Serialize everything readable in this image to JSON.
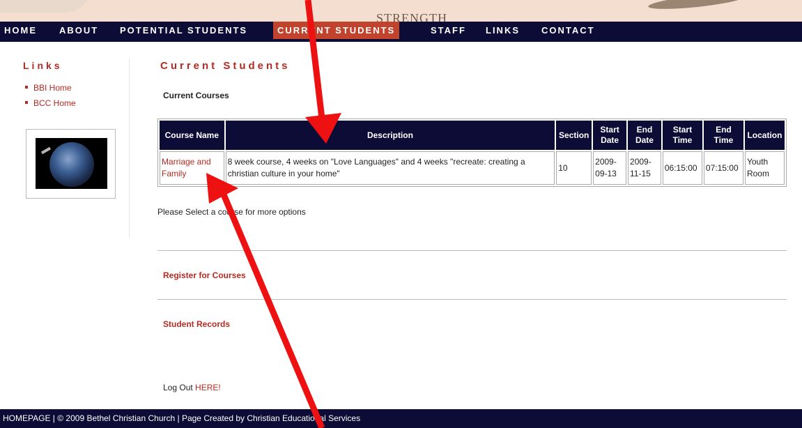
{
  "banner": {
    "text": "STRENGTH"
  },
  "nav": {
    "items": [
      {
        "label": "HOME"
      },
      {
        "label": "ABOUT"
      },
      {
        "label": "POTENTIAL STUDENTS"
      },
      {
        "label": "CURRENT STUDENTS"
      },
      {
        "label": "STAFF"
      },
      {
        "label": "LINKS"
      },
      {
        "label": "CONTACT"
      }
    ],
    "active_color": "#c0432e",
    "bar_color": "#0c0c36"
  },
  "sidebar": {
    "title": "Links",
    "links": [
      {
        "label": "BBI Home"
      },
      {
        "label": "BCC Home"
      }
    ]
  },
  "main": {
    "title": "Current Students",
    "subtitle": "Current Courses",
    "table": {
      "headers": [
        "Course Name",
        "Description",
        "Section",
        "Start Date",
        "End Date",
        "Start Time",
        "End Time",
        "Location"
      ],
      "rows": [
        {
          "course_name": "Marriage and Family",
          "description": "8 week course, 4 weeks on \"Love Languages\" and 4 weeks \"recreate: creating a christian culture in your home\"",
          "section": "10",
          "start_date": "2009-09-13",
          "end_date": "2009-11-15",
          "start_time": "06:15:00",
          "end_time": "07:15:00",
          "location": "Youth Room"
        }
      ]
    },
    "note": "Please Select a course for more options",
    "register_link": "Register for Courses",
    "records_link": "Student Records",
    "logout_prefix": "Log Out",
    "logout_link": "HERE!"
  },
  "footer": {
    "text": "HOMEPAGE | © 2009 Bethel Christian Church | Page Created by Christian Educational Services"
  },
  "colors": {
    "accent_red": "#b52a22",
    "annotation_arrow": "#ee1111"
  }
}
